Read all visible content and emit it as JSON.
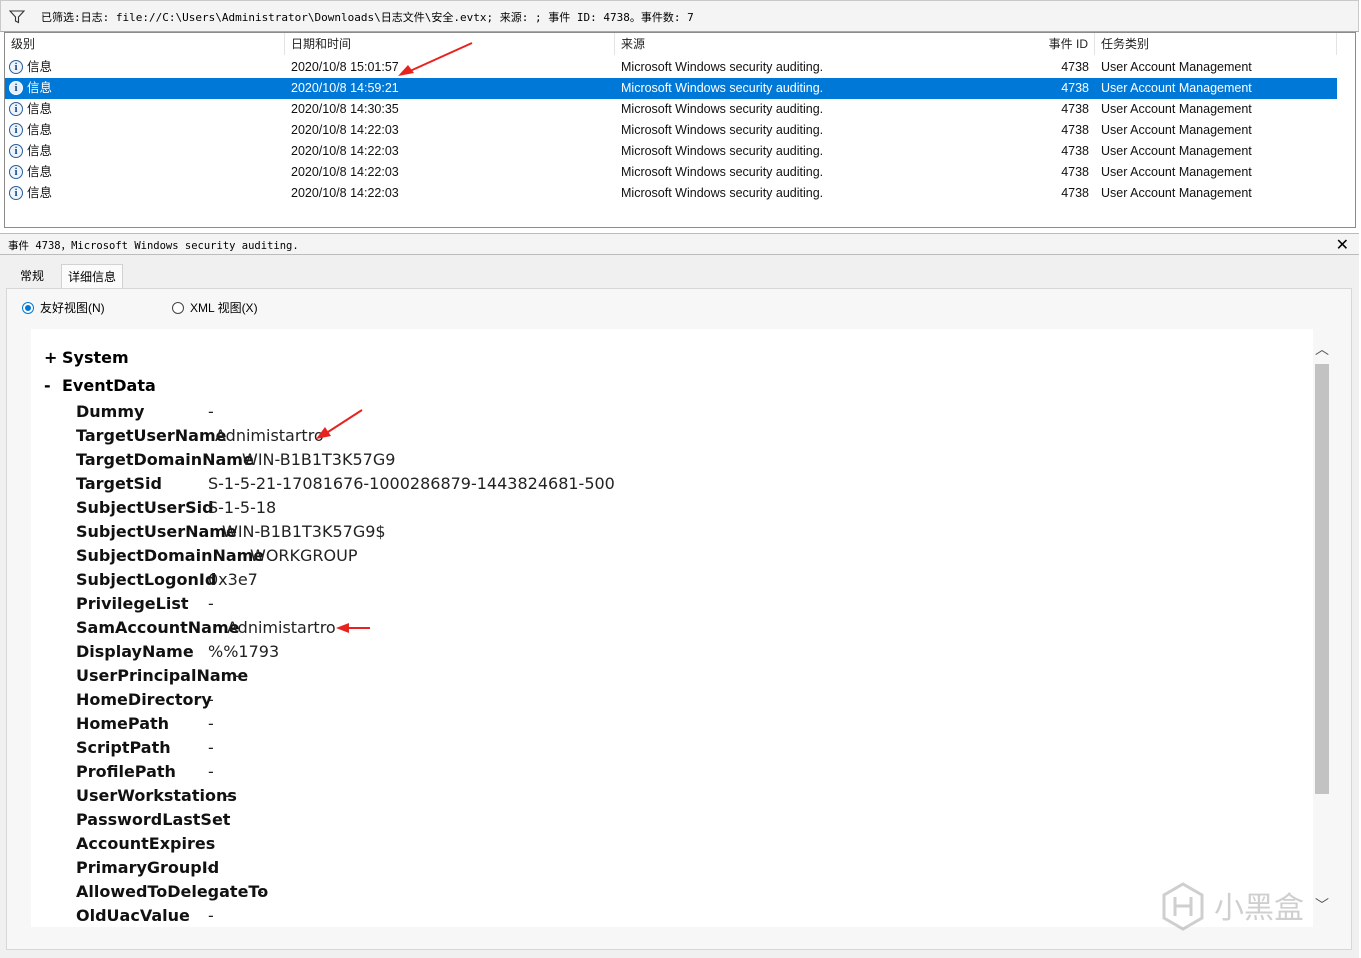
{
  "filter": {
    "text": "已筛选:日志: file://C:\\Users\\Administrator\\Downloads\\日志文件\\安全.evtx; 来源: ; 事件 ID: 4738。事件数: 7"
  },
  "table": {
    "columns": [
      "级别",
      "日期和时间",
      "来源",
      "事件 ID",
      "任务类别"
    ],
    "rows": [
      {
        "level": "信息",
        "datetime": "2020/10/8 15:01:57",
        "source": "Microsoft Windows security auditing.",
        "event_id": "4738",
        "category": "User Account Management"
      },
      {
        "level": "信息",
        "datetime": "2020/10/8 14:59:21",
        "source": "Microsoft Windows security auditing.",
        "event_id": "4738",
        "category": "User Account Management"
      },
      {
        "level": "信息",
        "datetime": "2020/10/8 14:30:35",
        "source": "Microsoft Windows security auditing.",
        "event_id": "4738",
        "category": "User Account Management"
      },
      {
        "level": "信息",
        "datetime": "2020/10/8 14:22:03",
        "source": "Microsoft Windows security auditing.",
        "event_id": "4738",
        "category": "User Account Management"
      },
      {
        "level": "信息",
        "datetime": "2020/10/8 14:22:03",
        "source": "Microsoft Windows security auditing.",
        "event_id": "4738",
        "category": "User Account Management"
      },
      {
        "level": "信息",
        "datetime": "2020/10/8 14:22:03",
        "source": "Microsoft Windows security auditing.",
        "event_id": "4738",
        "category": "User Account Management"
      },
      {
        "level": "信息",
        "datetime": "2020/10/8 14:22:03",
        "source": "Microsoft Windows security auditing.",
        "event_id": "4738",
        "category": "User Account Management"
      }
    ],
    "selected_row": 1
  },
  "detail": {
    "title": "事件 4738，Microsoft Windows security auditing.",
    "close": "✕",
    "tabs": [
      "常规",
      "详细信息"
    ],
    "active_tab": 1,
    "view_friendly": "友好视图(N)",
    "view_xml": "XML 视图(X)",
    "system_sign": "+",
    "system_label": "System",
    "eventdata_sign": "-",
    "eventdata_label": "EventData",
    "fields": [
      {
        "name": "Dummy",
        "value": "-"
      },
      {
        "name": "TargetUserName",
        "value": "Adnimistartro"
      },
      {
        "name": "TargetDomainName",
        "value": "WIN-B1B1T3K57G9"
      },
      {
        "name": "TargetSid",
        "value": "S-1-5-21-17081676-1000286879-1443824681-500"
      },
      {
        "name": "SubjectUserSid",
        "value": "S-1-5-18"
      },
      {
        "name": "SubjectUserName",
        "value": "WIN-B1B1T3K57G9$"
      },
      {
        "name": "SubjectDomainName",
        "value": "WORKGROUP"
      },
      {
        "name": "SubjectLogonId",
        "value": "0x3e7"
      },
      {
        "name": "PrivilegeList",
        "value": "-"
      },
      {
        "name": "SamAccountName",
        "value": "Adnimistartro"
      },
      {
        "name": "DisplayName",
        "value": "%%1793"
      },
      {
        "name": "UserPrincipalName",
        "value": "-"
      },
      {
        "name": "HomeDirectory",
        "value": "-"
      },
      {
        "name": "HomePath",
        "value": "-"
      },
      {
        "name": "ScriptPath",
        "value": "-"
      },
      {
        "name": "ProfilePath",
        "value": "-"
      },
      {
        "name": "UserWorkstations",
        "value": "-"
      },
      {
        "name": "PasswordLastSet",
        "value": "-"
      },
      {
        "name": "AccountExpires",
        "value": "-"
      },
      {
        "name": "PrimaryGroupId",
        "value": "-"
      },
      {
        "name": "AllowedToDelegateTo",
        "value": "-"
      },
      {
        "name": "OldUacValue",
        "value": "-"
      }
    ]
  },
  "colors": {
    "selection": "#0078d7",
    "annotation_arrow": "#e8231f"
  },
  "watermark": "小黑盒"
}
